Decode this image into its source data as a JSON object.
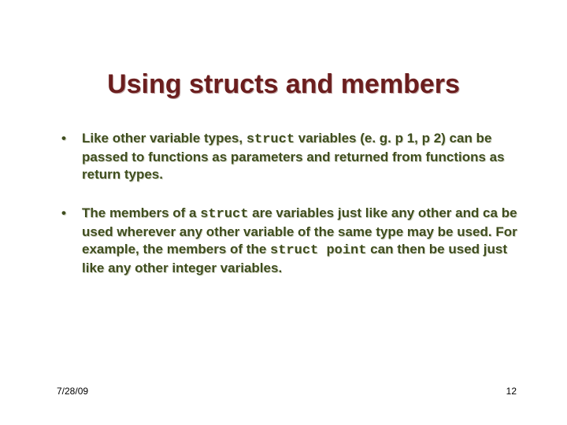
{
  "title": "Using structs and members",
  "bullets": [
    {
      "pre1": "Like other variable types, ",
      "code1": "struct",
      "post1": " variables (e. g. p 1, p 2) can be passed to functions as parameters and returned from functions as return types."
    },
    {
      "pre1": "The members of a ",
      "code1": "struct",
      "mid1": " are variables just like any other and ca be used wherever any other variable of the same type may be used. For example, the  members of the ",
      "code2": "struct point",
      "post1": " can then be used just like any other integer variables."
    }
  ],
  "footer": {
    "date": "7/28/09",
    "page": "12"
  }
}
